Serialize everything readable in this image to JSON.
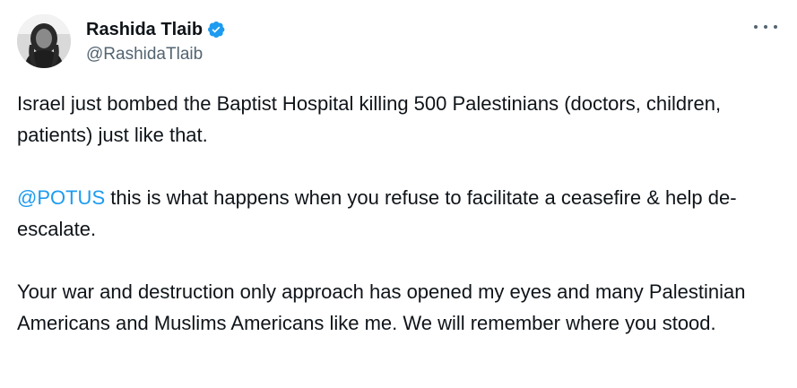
{
  "author": {
    "display_name": "Rashida Tlaib",
    "handle": "@RashidaTlaib",
    "verified_icon": "verified-badge-icon",
    "avatar_icon": "profile-photo"
  },
  "menu": {
    "more_icon": "more-options-icon"
  },
  "tweet": {
    "paragraph1": "Israel just bombed the Baptist Hospital killing 500 Palestinians (doctors, children, patients) just like that.",
    "mention": "@POTUS",
    "paragraph2_rest": " this is what happens when you refuse to facilitate a ceasefire & help de-escalate.",
    "paragraph3": "Your war and destruction only approach has opened my eyes and many Palestinian Americans and Muslims Americans like me. We will remember where you stood."
  },
  "colors": {
    "text": "#0f1419",
    "secondary": "#536471",
    "accent": "#1d9bf0"
  }
}
